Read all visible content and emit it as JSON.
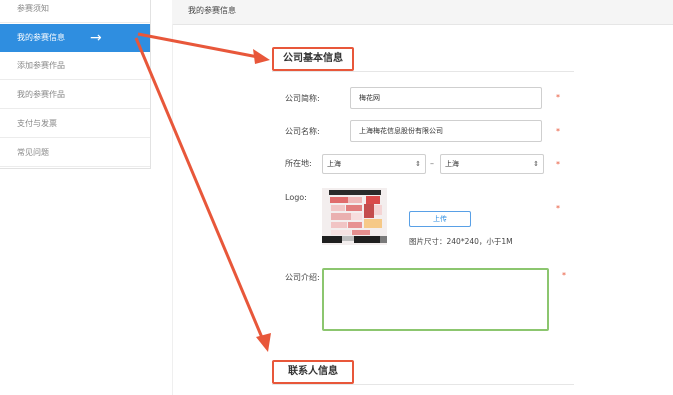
{
  "sidebar": {
    "items": [
      {
        "label": "参赛须知"
      },
      {
        "label": "我的参赛信息",
        "active": true
      },
      {
        "label": "添加参赛作品"
      },
      {
        "label": "我的参赛作品"
      },
      {
        "label": "支付与发票"
      },
      {
        "label": "常见问题"
      }
    ],
    "active_arrow": "→"
  },
  "header": {
    "title": "我的参赛信息"
  },
  "company_section": {
    "title": "公司基本信息",
    "short_name": {
      "label": "公司简称:",
      "value": "梅花网"
    },
    "full_name": {
      "label": "公司名称:",
      "value": "上海梅花信息股份有限公司"
    },
    "location": {
      "label": "所在地:",
      "province": "上海",
      "city": "上海",
      "separator": "–"
    },
    "logo": {
      "label": "Logo:",
      "upload_label": "上传",
      "size_hint": "图片尺寸：240*240，小于1M"
    },
    "intro": {
      "label": "公司介绍:",
      "value": ""
    },
    "required_mark": "*"
  },
  "contact_section": {
    "title": "联系人信息"
  },
  "colors": {
    "accent": "#2f8ee0",
    "annotation": "#e8573a",
    "focus": "#8cc66f"
  },
  "icons": {
    "active_arrow": "arrow-right-icon",
    "select_chevron": "chevron-updown-icon"
  }
}
